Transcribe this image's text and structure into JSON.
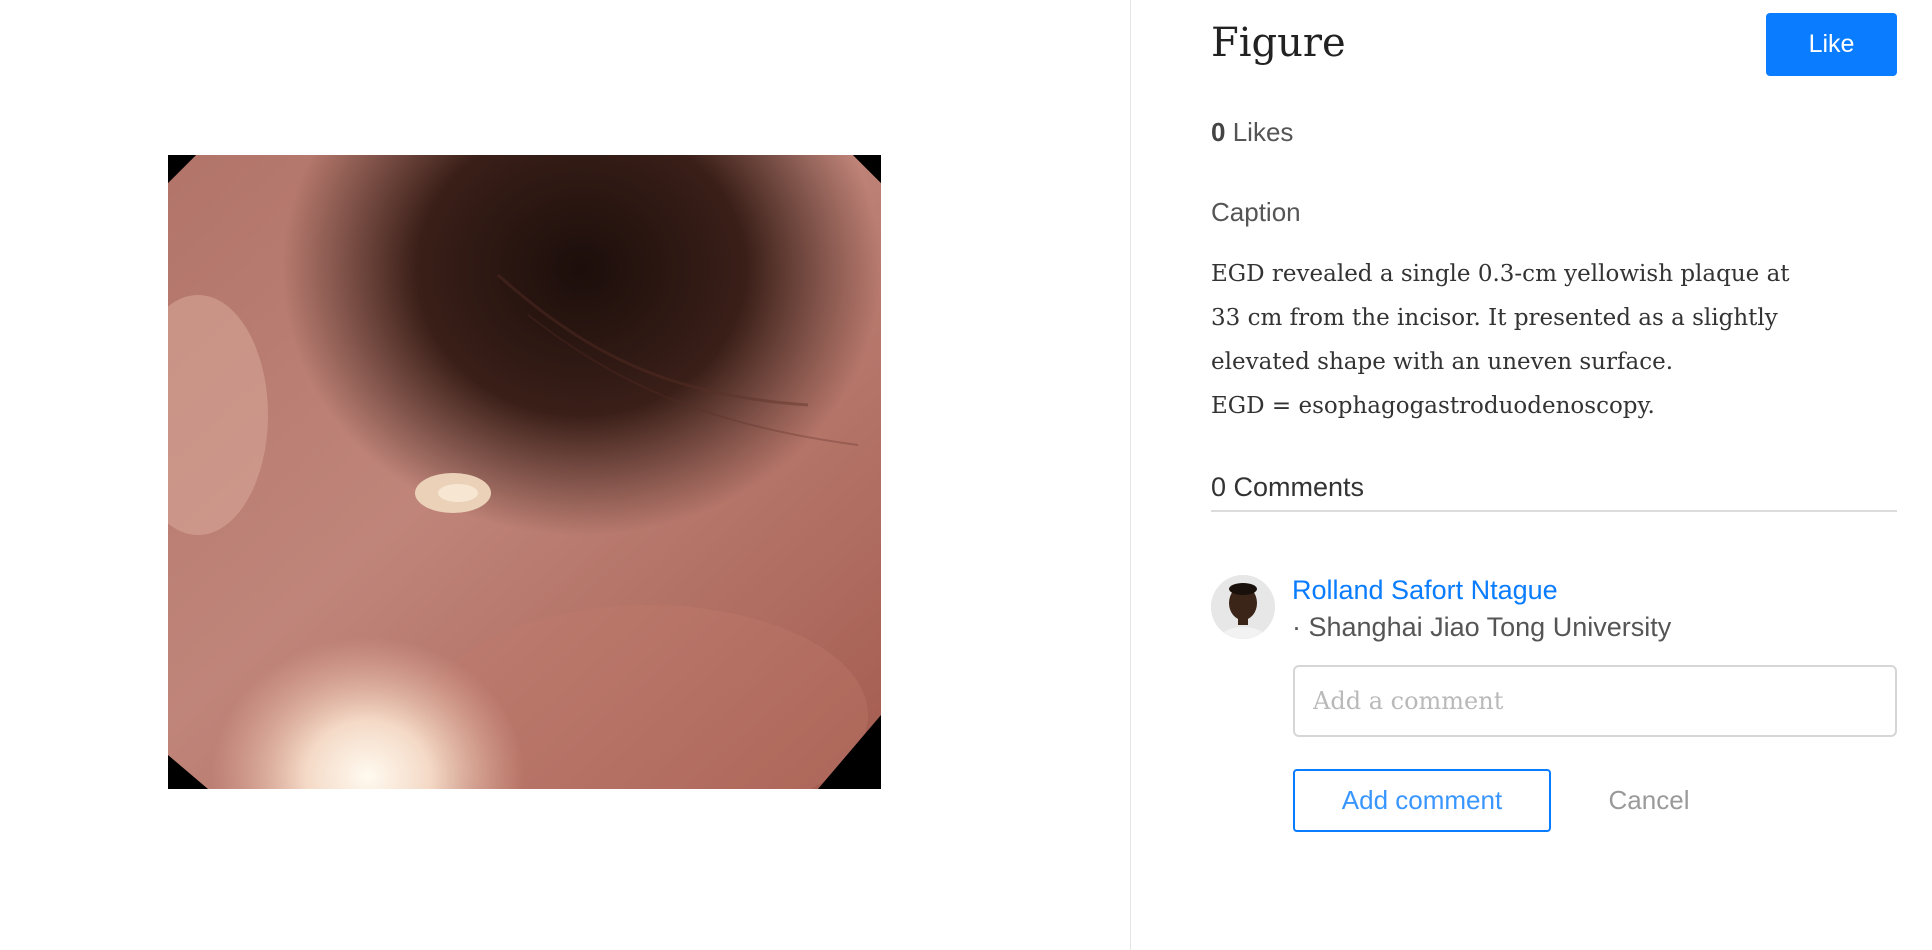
{
  "figure": {
    "title": "Figure",
    "like_label": "Like",
    "likes_count": "0",
    "likes_label": "Likes",
    "caption_heading": "Caption",
    "caption_text": "EGD revealed a single 0.3-cm yellowish plaque at\n33 cm from the incisor. It presented as a slightly\nelevated shape with an uneven surface.\nEGD = esophagogastroduodenoscopy."
  },
  "comments": {
    "heading": "0 Comments",
    "user": {
      "name": "Rolland Safort Ntague",
      "affiliation": "· Shanghai Jiao Tong University"
    },
    "input_placeholder": "Add a comment",
    "add_label": "Add comment",
    "cancel_label": "Cancel"
  },
  "colors": {
    "accent": "#0a7cff",
    "divider": "#e6e6e6"
  },
  "icons": {
    "avatar": "user-avatar-photo"
  }
}
